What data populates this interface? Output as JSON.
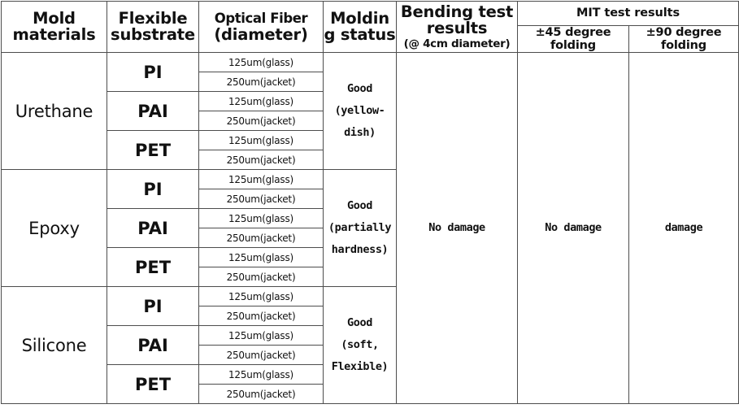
{
  "table": {
    "headers": {
      "mold_materials": "Mold materials",
      "mold_materials_l1": "Mold",
      "mold_materials_l2": "materials",
      "flexible_substrate_l1": "Flexible",
      "flexible_substrate_l2": "substrate",
      "optical_fiber_l1": "Optical Fiber",
      "optical_fiber_l2": "(diameter)",
      "molding_status_l1": "Moldin",
      "molding_status_l2": "g status",
      "bending_l1": "Bending test",
      "bending_l2": "results",
      "bending_l3": "(@ 4cm diameter)",
      "mit_group": "MIT test results",
      "mit_45_l1": "±45 degree",
      "mit_45_l2": "folding",
      "mit_90_l1": "±90 degree",
      "mit_90_l2": "folding"
    },
    "fiber_values": {
      "glass": "125um(glass)",
      "jacket": "250um(jacket)"
    },
    "sections": [
      {
        "mold_material": "Urethane",
        "substrates": [
          "PI",
          "PAI",
          "PET"
        ],
        "molding_status_lines": [
          "Good",
          "(yellow-dish)"
        ]
      },
      {
        "mold_material": "Epoxy",
        "substrates": [
          "PI",
          "PAI",
          "PET"
        ],
        "molding_status_lines": [
          "Good",
          "(partially",
          "hardness)"
        ]
      },
      {
        "mold_material": "Silicone",
        "substrates": [
          "PI",
          "PAI",
          "PET"
        ],
        "molding_status_lines": [
          "Good",
          "(soft, Flexible)"
        ]
      }
    ],
    "results": {
      "bending": "No damage",
      "mit_45": "No damage",
      "mit_90": "damage"
    },
    "colors": {
      "header_green": "#82c341",
      "border": "#4d4d4d",
      "text": "#111111",
      "background": "#ffffff"
    }
  }
}
